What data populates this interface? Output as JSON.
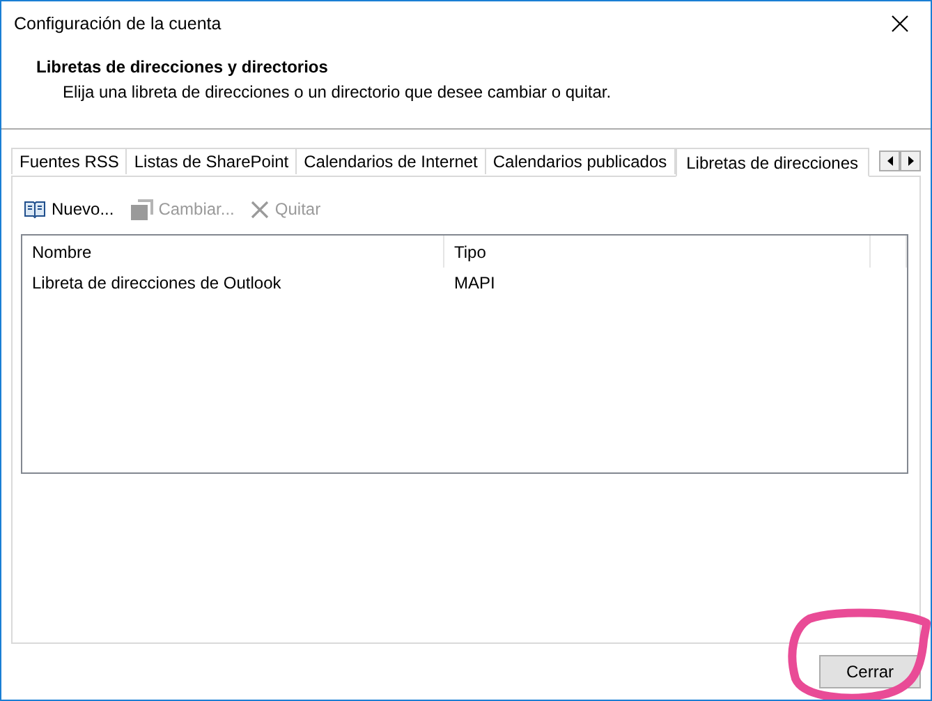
{
  "window": {
    "title": "Configuración de la cuenta"
  },
  "header": {
    "heading": "Libretas de direcciones y directorios",
    "description": "Elija una libreta de direcciones o un directorio que desee cambiar o quitar."
  },
  "tabs": [
    {
      "label": "Fuentes RSS",
      "selected": false
    },
    {
      "label": "Listas de SharePoint",
      "selected": false
    },
    {
      "label": "Calendarios de Internet",
      "selected": false
    },
    {
      "label": "Calendarios publicados",
      "selected": false
    },
    {
      "label": "Libretas de direcciones",
      "selected": true
    }
  ],
  "toolbar": [
    {
      "kind": "new",
      "label": "Nuevo...",
      "disabled": false
    },
    {
      "kind": "change",
      "label": "Cambiar...",
      "disabled": true
    },
    {
      "kind": "remove",
      "label": "Quitar",
      "disabled": true
    }
  ],
  "table": {
    "columns": [
      "Nombre",
      "Tipo"
    ],
    "rows": [
      {
        "cells": [
          "Libreta de direcciones de Outlook",
          "MAPI"
        ]
      }
    ]
  },
  "buttons": [
    "Cerrar"
  ]
}
